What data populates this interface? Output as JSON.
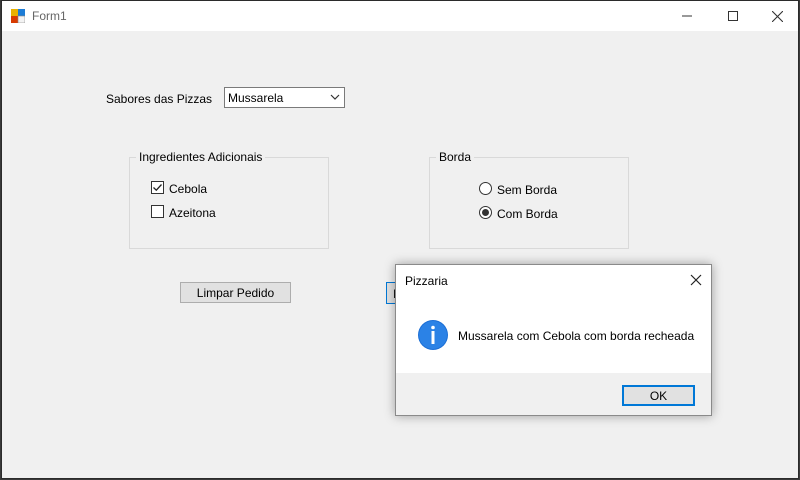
{
  "window": {
    "title": "Form1",
    "app_icon": "winforms-app-icon",
    "minimize": "minimize-icon",
    "maximize": "maximize-icon",
    "close": "close-icon"
  },
  "form": {
    "flavor_label": "Sabores das Pizzas",
    "flavor_selected": "Mussarela",
    "ingredients": {
      "title": "Ingredientes Adicionais",
      "items": [
        {
          "label": "Cebola",
          "checked": true
        },
        {
          "label": "Azeitona",
          "checked": false
        }
      ]
    },
    "border": {
      "title": "Borda",
      "options": [
        {
          "label": "Sem Borda",
          "selected": false
        },
        {
          "label": "Com Borda",
          "selected": true
        }
      ]
    },
    "clear_button": "Limpar Pedido",
    "hidden_button_visible_text": "I"
  },
  "dialog": {
    "title": "Pizzaria",
    "message": "Mussarela com Cebola com borda recheada",
    "icon": "info-icon",
    "ok_label": "OK"
  },
  "colors": {
    "accent": "#0078d7",
    "window_bg": "#f0f0f0"
  }
}
